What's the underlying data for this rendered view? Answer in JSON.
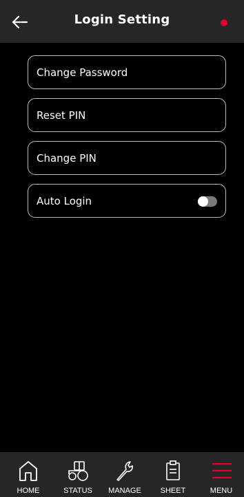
{
  "header": {
    "title": "Login Setting",
    "back_icon": "arrow-left-icon",
    "status_dot_color": "#e4002b"
  },
  "settings": {
    "items": [
      {
        "label": "Change Password"
      },
      {
        "label": "Reset PIN"
      },
      {
        "label": "Change PIN"
      },
      {
        "label": "Auto Login",
        "toggle": "off"
      }
    ]
  },
  "navbar": {
    "items": [
      {
        "label": "HOME",
        "icon": "home-icon"
      },
      {
        "label": "STATUS",
        "icon": "tractor-icon"
      },
      {
        "label": "MANAGE",
        "icon": "wrench-icon"
      },
      {
        "label": "SHEET",
        "icon": "clipboard-icon"
      },
      {
        "label": "MENU",
        "icon": "hamburger-menu-icon",
        "active_color": "#e4002b"
      }
    ]
  }
}
